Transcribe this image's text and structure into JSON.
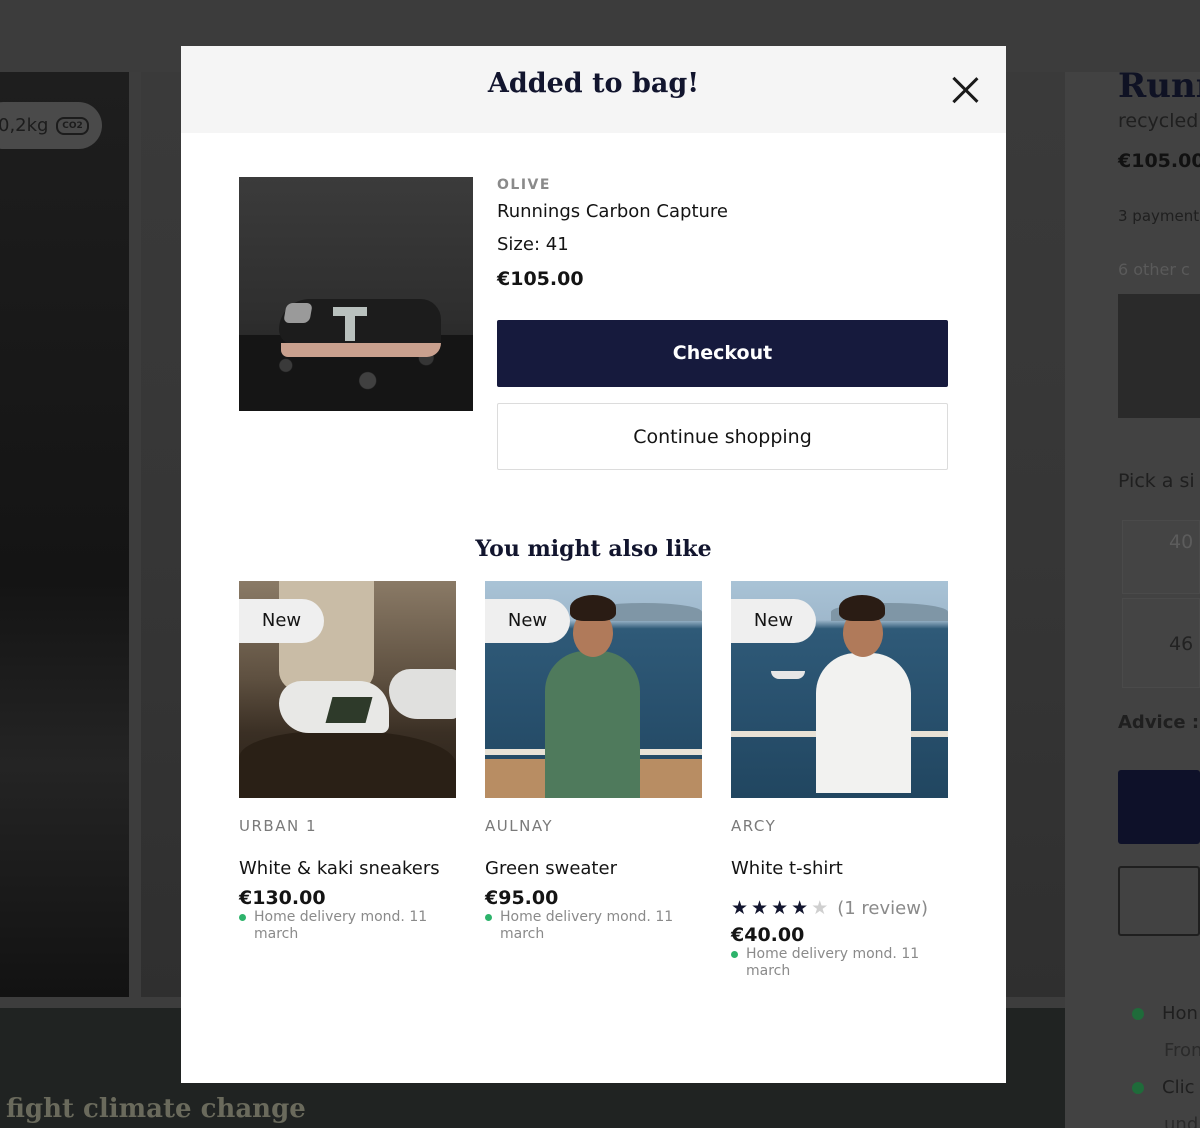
{
  "background": {
    "co2": "0,2kg",
    "co2_badge": "CO2",
    "product_title": "Runn",
    "product_subtitle": "recycled",
    "price": "€105.00",
    "payment": "3 payment",
    "other_colors": "6 other c",
    "pick_size": "Pick a si",
    "sizes": [
      "40",
      "46"
    ],
    "advice": "Advice : ",
    "delivery_items": [
      "Hon",
      "Fron",
      "Clic",
      "und"
    ],
    "banner_text": "fight climate change"
  },
  "modal": {
    "title": "Added to bag!",
    "product": {
      "brand": "OLIVE",
      "name": "Runnings Carbon Capture",
      "size": "Size: 41",
      "price": "€105.00"
    },
    "checkout_label": "Checkout",
    "continue_label": "Continue shopping",
    "recommendations_title": "You might also like",
    "recommendations": [
      {
        "badge": "New",
        "brand": "URBAN 1",
        "name": "White & kaki sneakers",
        "price": "€130.00",
        "delivery": "Home delivery mond. 11 march"
      },
      {
        "badge": "New",
        "brand": "AULNAY",
        "name": "Green sweater",
        "price": "€95.00",
        "delivery": "Home delivery mond. 11 march"
      },
      {
        "badge": "New",
        "brand": "ARCY",
        "name": "White t-shirt",
        "rating": 4,
        "rating_max": 5,
        "reviews": "(1 review)",
        "price": "€40.00",
        "delivery": "Home delivery mond. 11 march"
      }
    ]
  },
  "colors": {
    "navy": "#161a3d",
    "delivery_dot": "#2db36b"
  }
}
